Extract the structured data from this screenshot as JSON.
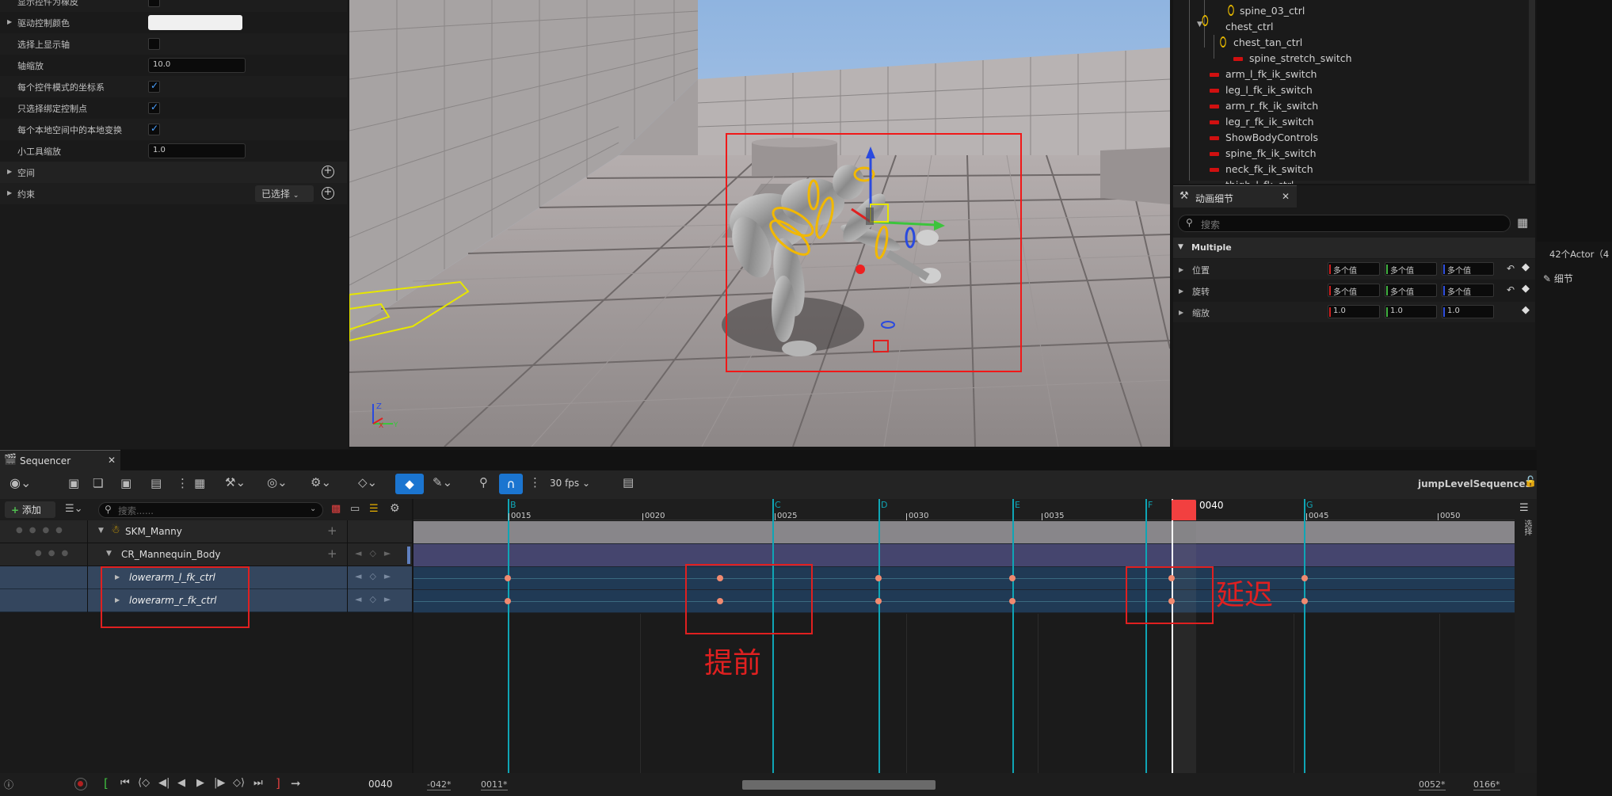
{
  "details_top": {
    "rows": [
      {
        "label": "显示控件为橡皮",
        "type": "check",
        "checked": false
      },
      {
        "label": "驱动控制颜色",
        "type": "color"
      },
      {
        "label": "选择上显示轴",
        "type": "check",
        "checked": false
      },
      {
        "label": "轴缩放",
        "type": "text",
        "value": "10.0"
      },
      {
        "label": "每个控件模式的坐标系",
        "type": "check",
        "checked": true
      },
      {
        "label": "只选择绑定控制点",
        "type": "check",
        "checked": true
      },
      {
        "label": "每个本地空间中的本地变换",
        "type": "check",
        "checked": true
      },
      {
        "label": "小工具缩放",
        "type": "text",
        "value": "1.0"
      }
    ],
    "space_label": "空间",
    "constraint_label": "约束",
    "selected_dropdown": "已选择"
  },
  "hierarchy": {
    "items": [
      {
        "label": "spine_03_ctrl",
        "kind": "ring"
      },
      {
        "label": "chest_ctrl",
        "kind": "ring"
      },
      {
        "label": "chest_tan_ctrl",
        "kind": "ring"
      },
      {
        "label": "spine_stretch_switch",
        "kind": "red"
      },
      {
        "label": "arm_l_fk_ik_switch",
        "kind": "red"
      },
      {
        "label": "leg_l_fk_ik_switch",
        "kind": "red"
      },
      {
        "label": "arm_r_fk_ik_switch",
        "kind": "red"
      },
      {
        "label": "leg_r_fk_ik_switch",
        "kind": "red"
      },
      {
        "label": "ShowBodyControls",
        "kind": "red"
      },
      {
        "label": "spine_fk_ik_switch",
        "kind": "red"
      },
      {
        "label": "neck_fk_ik_switch",
        "kind": "red"
      },
      {
        "label": "thigh_l_fk_ctrl",
        "kind": "ring"
      }
    ]
  },
  "anim_details": {
    "tab_title": "动画细节",
    "search_placeholder": "搜索",
    "section": "Multiple",
    "rows": [
      {
        "label": "位置",
        "values": [
          "多个值",
          "多个值",
          "多个值"
        ]
      },
      {
        "label": "旋转",
        "values": [
          "多个值",
          "多个值",
          "多个值"
        ]
      },
      {
        "label": "缩放",
        "values": [
          "1.0",
          "1.0",
          "1.0"
        ]
      }
    ]
  },
  "right_panel": {
    "actor_count": "42个Actor（4",
    "details_label": "细节"
  },
  "sequencer": {
    "tab_title": "Sequencer",
    "fps": "30 fps",
    "sequence_name": "jumpLevelSequence3",
    "add_label": "添加",
    "search_placeholder": "搜索......",
    "select_label": "选择",
    "tracks": [
      "SKM_Manny",
      "CR_Mannequin_Body",
      "lowerarm_l_fk_ctrl",
      "lowerarm_r_fk_ctrl"
    ],
    "ticks": [
      "0015",
      "0020",
      "0025",
      "0030",
      "0035",
      "0040",
      "0045",
      "0050"
    ],
    "markers": [
      "B",
      "C",
      "D",
      "E",
      "F",
      "G"
    ],
    "current_frame": "0040",
    "range_start": "-042*",
    "range_in": "0011*",
    "range_out": "0052*",
    "range_end": "0166*"
  },
  "annotations": {
    "early": "提前",
    "late": "延迟"
  },
  "colors": {
    "accent": "#0fa5b5",
    "selection": "#f24040",
    "annotation": "#e02020",
    "track_blue": "#203a55",
    "keyframe": "#f08a70"
  }
}
